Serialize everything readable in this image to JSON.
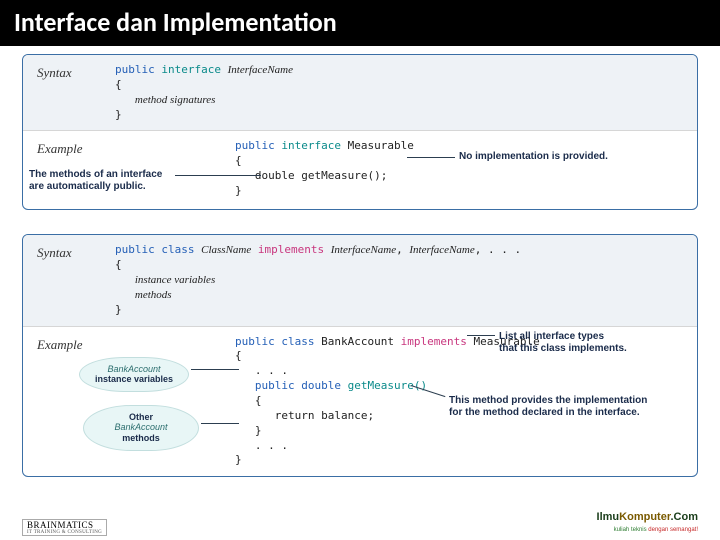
{
  "title": "Interface dan Implementation",
  "panel1": {
    "syntax_label": "Syntax",
    "example_label": "Example",
    "syntax_public": "public",
    "syntax_interface": "interface",
    "syntax_ifname": "InterfaceName",
    "syntax_sig": "method signatures",
    "ex_public": "public",
    "ex_interface": "interface",
    "ex_name": "Measurable",
    "ex_method": "double getMeasure();",
    "annot_left_l1": "The methods of an interface",
    "annot_left_l2": "are automatically public.",
    "annot_right": "No implementation is provided."
  },
  "panel2": {
    "syntax_label": "Syntax",
    "example_label": "Example",
    "syntax_public": "public",
    "syntax_class": "class",
    "syntax_cname": "ClassName",
    "syntax_implements": "implements",
    "syntax_if1": "InterfaceName",
    "syntax_if2": "InterfaceName",
    "syntax_tail": ", . . .",
    "syntax_ivars": "instance variables",
    "syntax_methods": "methods",
    "ex_public": "public",
    "ex_class": "class",
    "ex_cname": "BankAccount",
    "ex_implements": "implements",
    "ex_iface": "Measurable",
    "ex_dots": ". . .",
    "ex_pub2": "public",
    "ex_double": "double",
    "ex_meth": "getMeasure()",
    "ex_return": "return balance;",
    "annot_right_top_l1": "List all interface types",
    "annot_right_top_l2": "that this class implements.",
    "annot_right_bot_l1": "This method provides the implementation",
    "annot_right_bot_l2": "for the method declared in the interface.",
    "bubble_top_l1": "BankAccount",
    "bubble_top_l2": "instance variables",
    "bubble_bot_l1": "Other",
    "bubble_bot_l2_a": "BankAccount",
    "bubble_bot_l2_b": "methods"
  },
  "footer": {
    "left_brand": "BRAINMATICS",
    "left_sub": "IT TRAINING & CONSULTING",
    "right_a": "Ilmu",
    "right_b": "Komputer",
    "right_c": ".Com",
    "right_tag_a": "kuliah teknis ",
    "right_tag_b": "dengan semangat!"
  }
}
